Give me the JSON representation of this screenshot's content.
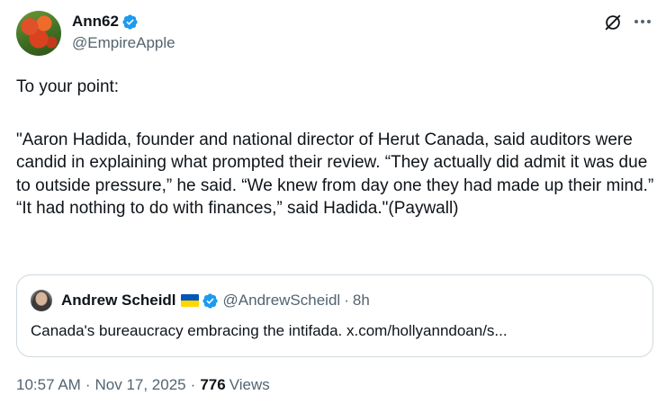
{
  "author": {
    "display_name": "Ann62",
    "handle": "@EmpireApple",
    "verified": true
  },
  "icons": {
    "verified": "verified-badge-icon",
    "grok": "grok-icon",
    "more": "more-icon"
  },
  "tweet": {
    "text_intro": "To your point:",
    "text_quote_1": "\"Aaron Hadida, founder and national director of Herut Canada, said auditors were candid in explaining what prompted their review. “They actually did admit it was due to outside pressure,” he said. “We knew from day one they had made up their mind.”",
    "text_quote_2": "“It had nothing to do with finances,” said Hadida.\"(Paywall)"
  },
  "quoted_tweet": {
    "display_name": "Andrew Scheidl",
    "flag": "ukraine-flag",
    "verified": true,
    "handle": "@AndrewScheidl",
    "separator": "·",
    "time": "8h",
    "text": "Canada's bureaucracy embracing the intifada. x.com/hollyanndoan/s..."
  },
  "meta": {
    "time": "10:57 AM",
    "separator": "·",
    "date": "Nov 17, 2025",
    "views_count": "776",
    "views_label": "Views"
  },
  "colors": {
    "text": "#0f1419",
    "secondary": "#536471",
    "verified_blue": "#1d9bf0",
    "border": "#cfd9de"
  }
}
